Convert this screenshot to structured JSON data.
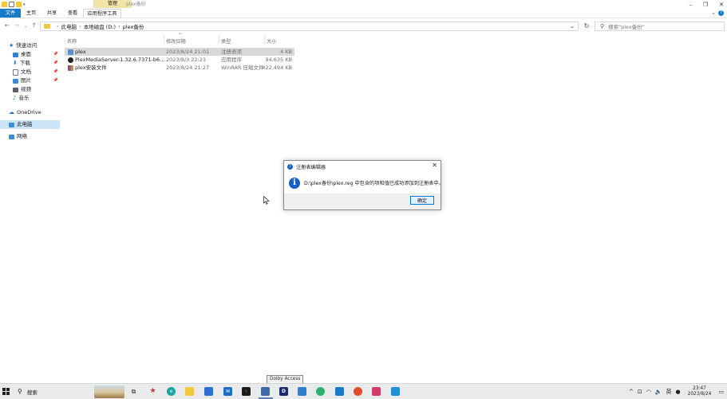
{
  "window": {
    "title": "plex备份",
    "manage_tab": "管理"
  },
  "ribbon": {
    "tabs": [
      "文件",
      "主页",
      "共享",
      "查看"
    ],
    "app_tools": "应用程序工具"
  },
  "address": {
    "crumbs": [
      "此电脑",
      "本地磁盘 (D:)",
      "plex备份"
    ]
  },
  "search": {
    "placeholder": "搜索\"plex备份\""
  },
  "navpane": {
    "quick_access": "快速访问",
    "items": [
      {
        "label": "桌面",
        "icon": "desktop-icon",
        "pinned": true
      },
      {
        "label": "下载",
        "icon": "download-icon",
        "pinned": true
      },
      {
        "label": "文档",
        "icon": "documents-icon",
        "pinned": true
      },
      {
        "label": "图片",
        "icon": "pictures-icon",
        "pinned": true
      },
      {
        "label": "视频",
        "icon": "videos-icon",
        "pinned": false
      },
      {
        "label": "音乐",
        "icon": "music-icon",
        "pinned": false
      }
    ],
    "onedrive": "OneDrive",
    "this_pc": "此电脑",
    "network": "网络"
  },
  "files": {
    "columns": [
      "名称",
      "修改日期",
      "类型",
      "大小"
    ],
    "rows": [
      {
        "name": "plex",
        "date": "2023/8/24 21:01",
        "type": "注册表项",
        "size": "4 KB",
        "selected": true
      },
      {
        "name": "PlexMediaServer-1.32.6.7371-b6a09a...",
        "date": "2023/8/3 22:23",
        "type": "应用程序",
        "size": "94,635 KB",
        "selected": false
      },
      {
        "name": "plex安装文件",
        "date": "2023/8/24 21:27",
        "type": "WinRAR 压缩文件",
        "size": "422,494 KB",
        "selected": false
      }
    ]
  },
  "dialog": {
    "title": "注册表编辑器",
    "message": "D:\\plex备份\\plex.reg 中包含的项和值已成功添加到注册表中。",
    "ok_label": "确定"
  },
  "tooltip": "Dolby Access",
  "taskbar": {
    "search_label": "搜索",
    "time": "23:47",
    "date": "2023/8/24"
  },
  "colors": {
    "accent": "#1979ca",
    "selection": "#cce4f7",
    "info": "#1760c4"
  }
}
